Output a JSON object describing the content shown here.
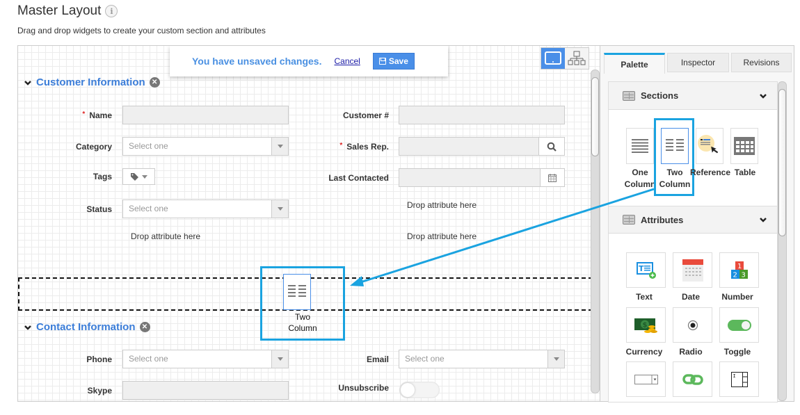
{
  "header": {
    "title": "Master Layout",
    "info_icon": "info-icon",
    "subtitle": "Drag and drop widgets to create your custom section and attributes"
  },
  "unsaved": {
    "message": "You have unsaved changes.",
    "cancel_label": "Cancel",
    "save_label": "Save"
  },
  "view_toggle": [
    {
      "name": "desktop-view",
      "icon": "monitor-icon",
      "active": true
    },
    {
      "name": "hierarchy-view",
      "icon": "hierarchy-icon",
      "active": false
    }
  ],
  "sections": [
    {
      "title": "Customer Information",
      "fields": [
        {
          "label": "Name",
          "required": true,
          "type": "text",
          "value": ""
        },
        {
          "label": "Customer #",
          "required": false,
          "type": "text",
          "value": ""
        },
        {
          "label": "Category",
          "required": false,
          "type": "select",
          "placeholder": "Select one"
        },
        {
          "label": "Sales Rep.",
          "required": true,
          "type": "lookup",
          "value": ""
        },
        {
          "label": "Tags",
          "required": false,
          "type": "tags"
        },
        {
          "label": "Last Contacted",
          "required": false,
          "type": "date",
          "value": ""
        },
        {
          "label": "Status",
          "required": false,
          "type": "select",
          "placeholder": "Select one"
        }
      ],
      "drop_placeholders": [
        "Drop attribute here",
        "Drop attribute here",
        "Drop attribute here"
      ]
    },
    {
      "title": "Contact Information",
      "fields": [
        {
          "label": "Phone",
          "type": "select",
          "placeholder": "Select one"
        },
        {
          "label": "Email",
          "type": "select",
          "placeholder": "Select one"
        },
        {
          "label": "Skype",
          "type": "text",
          "value": ""
        },
        {
          "label": "Unsubscribe",
          "type": "toggle",
          "value": false
        }
      ]
    }
  ],
  "drag_ghost": {
    "line1": "Two",
    "line2": "Column"
  },
  "panel": {
    "tabs": [
      {
        "label": "Palette",
        "active": true
      },
      {
        "label": "Inspector",
        "active": false
      },
      {
        "label": "Revisions",
        "active": false
      }
    ],
    "sections_header": "Sections",
    "section_widgets": [
      {
        "line1": "One",
        "line2": "Column",
        "icon": "one-column-icon"
      },
      {
        "line1": "Two",
        "line2": "Column",
        "icon": "two-column-icon",
        "highlighted": true
      },
      {
        "line1": "Reference",
        "line2": "",
        "icon": "reference-icon"
      },
      {
        "line1": "Table",
        "line2": "",
        "icon": "table-icon"
      }
    ],
    "attributes_header": "Attributes",
    "attribute_widgets": [
      {
        "label": "Text",
        "icon": "text-field-icon"
      },
      {
        "label": "Date",
        "icon": "calendar-icon"
      },
      {
        "label": "Number",
        "icon": "number-icon"
      },
      {
        "label": "Currency",
        "icon": "currency-icon"
      },
      {
        "label": "Radio",
        "icon": "radio-icon"
      },
      {
        "label": "Toggle",
        "icon": "toggle-icon"
      },
      {
        "label": "",
        "icon": "dropdown-icon"
      },
      {
        "label": "",
        "icon": "link-icon"
      },
      {
        "label": "",
        "icon": "textarea-icon"
      }
    ]
  },
  "colors": {
    "accent": "#4a8fe8",
    "highlight": "#1aa3e0",
    "section_title": "#3b7dd8",
    "required": "#dd2222"
  }
}
